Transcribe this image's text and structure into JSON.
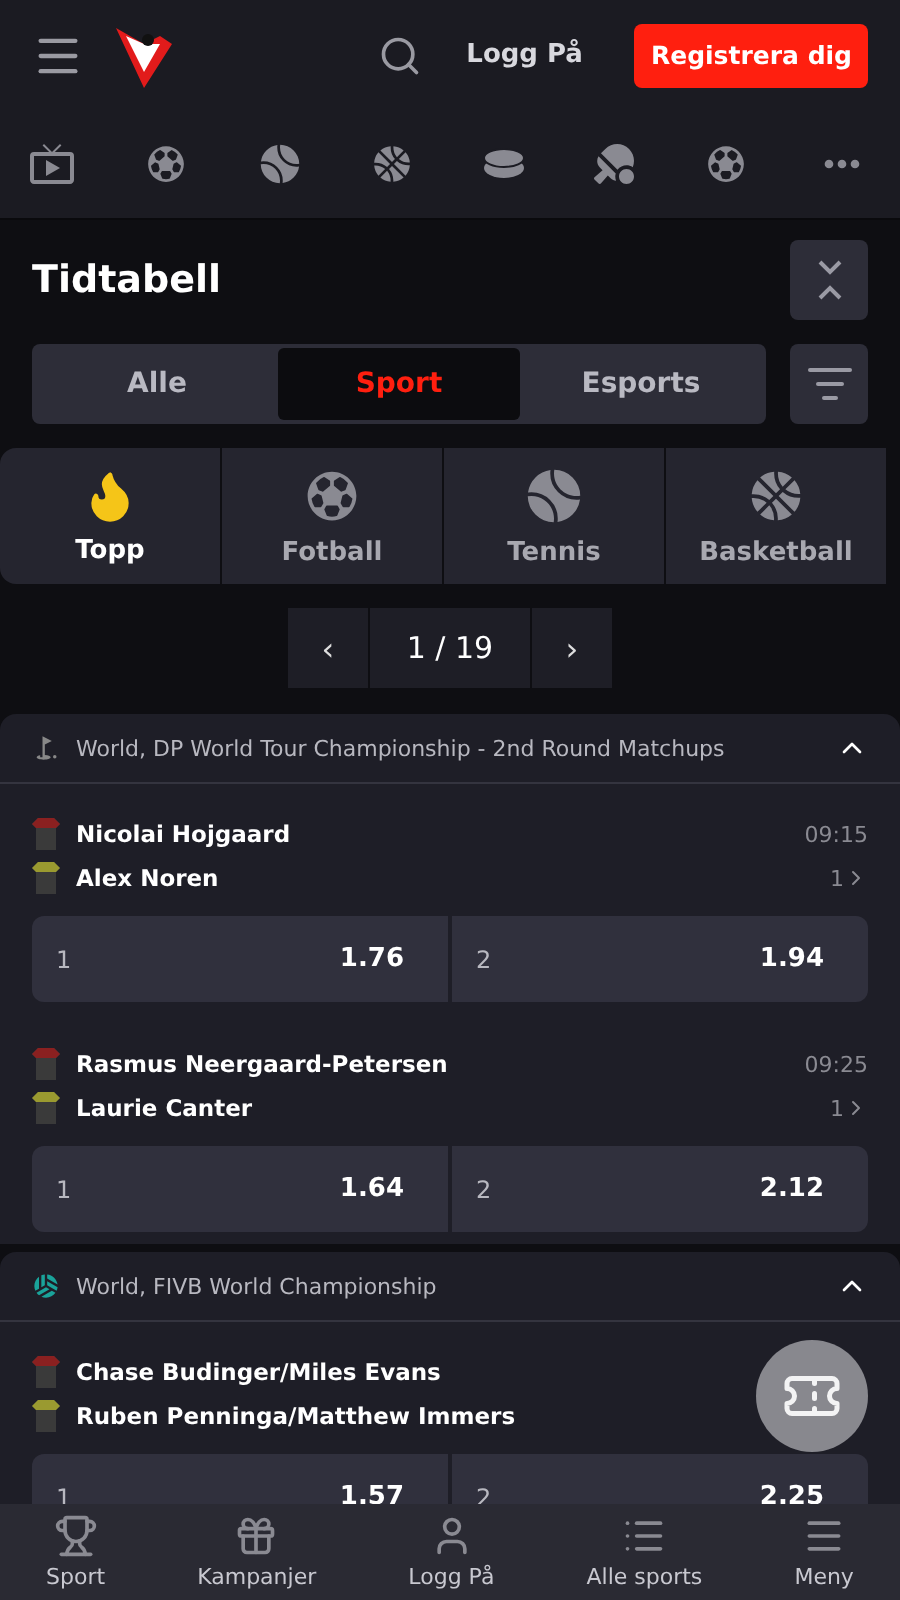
{
  "header": {
    "login": "Logg På",
    "register": "Registrera dig"
  },
  "title": "Tidtabell",
  "segments": [
    {
      "label": "Alle",
      "selected": false
    },
    {
      "label": "Sport",
      "selected": true
    },
    {
      "label": "Esports",
      "selected": false
    }
  ],
  "categories": [
    {
      "label": "Topp",
      "kind": "top",
      "selected": true
    },
    {
      "label": "Fotball",
      "kind": "football",
      "selected": false
    },
    {
      "label": "Tennis",
      "kind": "tennis",
      "selected": false
    },
    {
      "label": "Basketball",
      "kind": "basketball",
      "selected": false
    }
  ],
  "pager": {
    "prev": "‹",
    "page": "1 / 19",
    "next": "›"
  },
  "sections": [
    {
      "kind": "golf",
      "title": "World, DP World Tour Championship - 2nd Round Matchups",
      "matches": [
        {
          "home": "Nicolai Hojgaard",
          "away": "Alex Noren",
          "time": "09:15",
          "markets": "1",
          "odds": [
            {
              "label": "1",
              "value": "1.76"
            },
            {
              "label": "2",
              "value": "1.94"
            }
          ]
        },
        {
          "home": "Rasmus Neergaard-Petersen",
          "away": "Laurie Canter",
          "time": "09:25",
          "markets": "1",
          "odds": [
            {
              "label": "1",
              "value": "1.64"
            },
            {
              "label": "2",
              "value": "2.12"
            }
          ]
        }
      ]
    },
    {
      "kind": "volleyball",
      "title": "World, FIVB World Championship",
      "matches": [
        {
          "home": "Chase Budinger/Miles Evans",
          "away": "Ruben Penninga/Matthew Immers",
          "odds": [
            {
              "label": "1",
              "value": "1.57"
            },
            {
              "label": "2",
              "value": "2.25"
            }
          ]
        }
      ]
    }
  ],
  "nav": [
    {
      "label": "Sport",
      "kind": "trophy"
    },
    {
      "label": "Kampanjer",
      "kind": "gift"
    },
    {
      "label": "Logg På",
      "kind": "user"
    },
    {
      "label": "Alle sports",
      "kind": "list"
    },
    {
      "label": "Meny",
      "kind": "menu"
    }
  ]
}
